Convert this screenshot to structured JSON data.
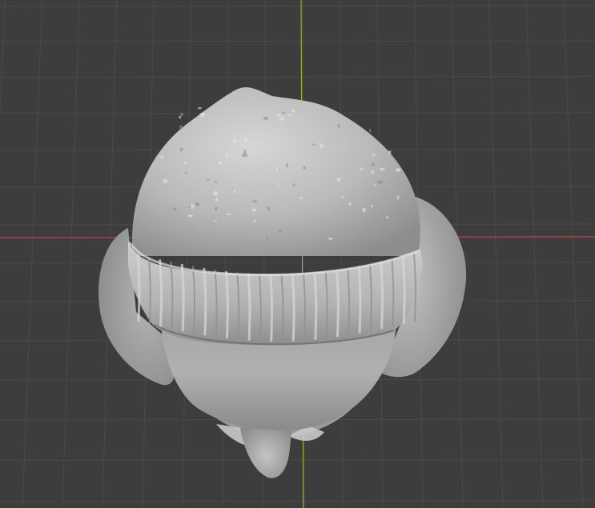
{
  "viewport": {
    "background_color": "#3d3d3d",
    "grid_line_color": "#4a4a4a",
    "grid_major_line_color": "#525252",
    "x_axis_color": "#c8414e",
    "y_axis_color": "#8fb332",
    "mesh_color": "#9b9b9b",
    "mesh_highlight_color": "#d9d9d9",
    "mesh_shadow_color": "#5a5a5a"
  },
  "object": {
    "icon": "sculpted-head-beanie"
  }
}
